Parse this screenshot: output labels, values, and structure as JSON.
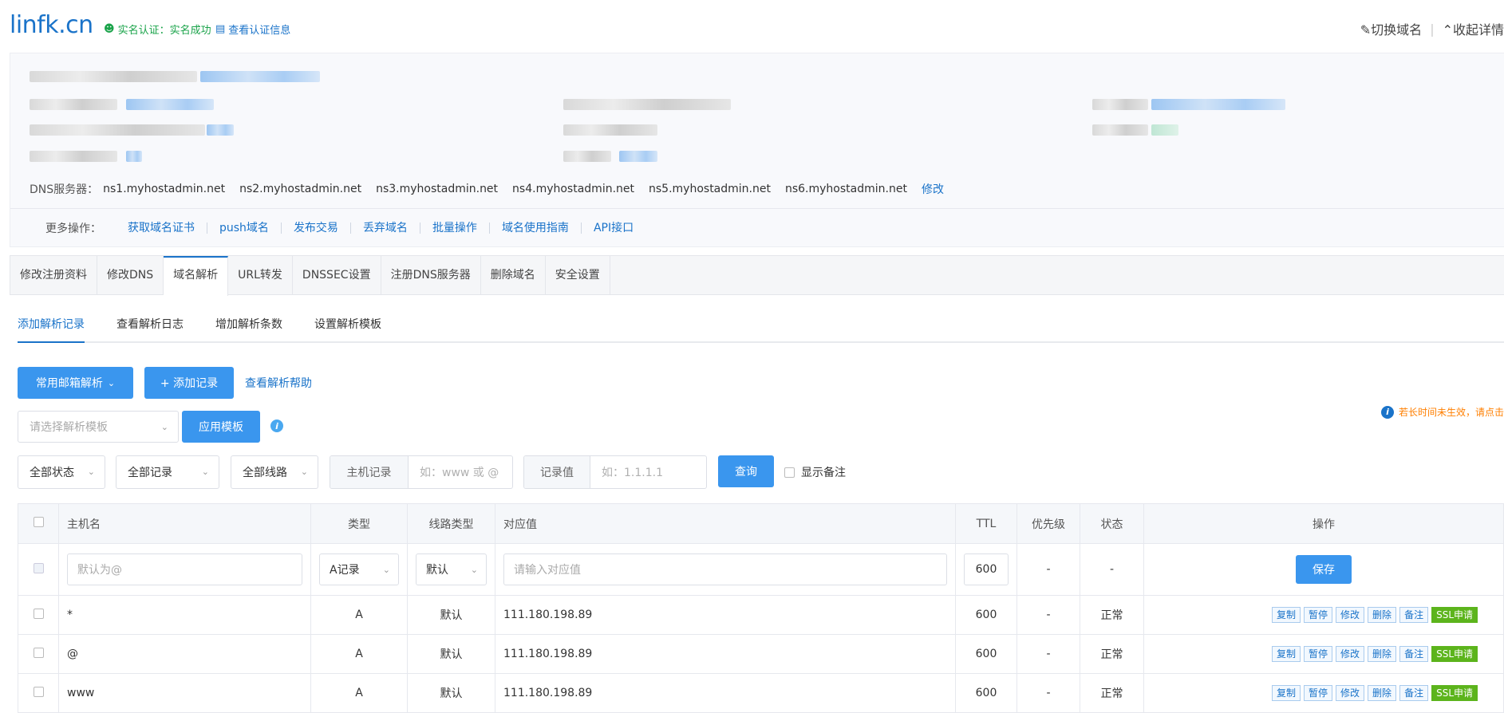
{
  "header": {
    "domain": "linfk.cn",
    "verify_status": "实名认证：实名成功",
    "view_verify": "查看认证信息",
    "switch_domain": "切换域名",
    "collapse": "收起详情"
  },
  "info": {
    "dns_label": "DNS服务器：",
    "dns_servers": [
      "ns1.myhostadmin.net",
      "ns2.myhostadmin.net",
      "ns3.myhostadmin.net",
      "ns4.myhostadmin.net",
      "ns5.myhostadmin.net",
      "ns6.myhostadmin.net"
    ],
    "dns_modify": "修改",
    "more_label": "更多操作：",
    "more_links": [
      "获取域名证书",
      "push域名",
      "发布交易",
      "丢弃域名",
      "批量操作",
      "域名使用指南",
      "API接口"
    ]
  },
  "tabs": [
    "修改注册资料",
    "修改DNS",
    "域名解析",
    "URL转发",
    "DNSSEC设置",
    "注册DNS服务器",
    "删除域名",
    "安全设置"
  ],
  "active_tab": "域名解析",
  "subtabs": [
    "添加解析记录",
    "查看解析日志",
    "增加解析条数",
    "设置解析模板"
  ],
  "toolbar": {
    "mail_btn": "常用邮箱解析",
    "add_btn": "+ 添加记录",
    "help_link": "查看解析帮助",
    "template_placeholder": "请选择解析模板",
    "apply_template": "应用模板",
    "notice": "若长时间未生效，请点击"
  },
  "filters": {
    "status": "全部状态",
    "record": "全部记录",
    "line": "全部线路",
    "host_label": "主机记录",
    "host_placeholder": "如：www 或 @",
    "value_label": "记录值",
    "value_placeholder": "如：1.1.1.1",
    "query": "查询",
    "show_remark": "显示备注"
  },
  "table": {
    "headers": {
      "host": "主机名",
      "type": "类型",
      "line": "线路类型",
      "value": "对应值",
      "ttl": "TTL",
      "priority": "优先级",
      "status": "状态",
      "ops": "操作"
    },
    "edit_row": {
      "host_placeholder": "默认为@",
      "type": "A记录",
      "line": "默认",
      "value_placeholder": "请输入对应值",
      "ttl": "600",
      "priority": "-",
      "status": "-",
      "save": "保存"
    },
    "rows": [
      {
        "host": "*",
        "type": "A",
        "line": "默认",
        "value": "111.180.198.89",
        "ttl": "600",
        "priority": "-",
        "status": "正常"
      },
      {
        "host": "@",
        "type": "A",
        "line": "默认",
        "value": "111.180.198.89",
        "ttl": "600",
        "priority": "-",
        "status": "正常"
      },
      {
        "host": "www",
        "type": "A",
        "line": "默认",
        "value": "111.180.198.89",
        "ttl": "600",
        "priority": "-",
        "status": "正常"
      }
    ],
    "row_ops": [
      "复制",
      "暂停",
      "修改",
      "删除",
      "备注",
      "SSL申请"
    ]
  }
}
